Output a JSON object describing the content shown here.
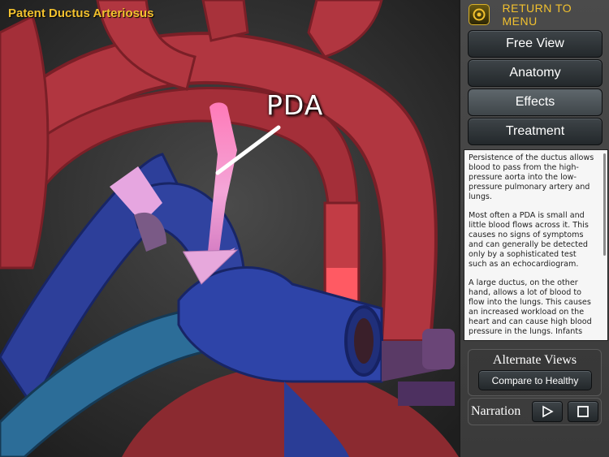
{
  "app": {
    "title": "Patent Ductus Arteriosus"
  },
  "viewport": {
    "annotation_label": "PDA"
  },
  "panel": {
    "return_label": "RETURN TO MENU",
    "nav": [
      {
        "label": "Free View",
        "active": false
      },
      {
        "label": "Anatomy",
        "active": false
      },
      {
        "label": "Effects",
        "active": true
      },
      {
        "label": "Treatment",
        "active": false
      }
    ],
    "description": [
      "Persistence of the ductus allows blood to pass from the high-pressure aorta into the low-pressure pulmonary artery and lungs.",
      "Most often a PDA is small and little blood flows across it. This causes no signs of symptoms and can generally be detected only by a sophisticated test such as an echocardiogram.",
      "A large ductus, on the other hand, allows a lot of blood to flow into the lungs. This causes an increased workload on the heart and can cause high blood pressure in the lungs. Infants"
    ],
    "alternate_views": {
      "title": "Alternate Views",
      "compare_label": "Compare to Healthy"
    },
    "narration": {
      "label": "Narration",
      "play_icon": "play-icon",
      "stop_icon": "stop-icon"
    }
  },
  "colors": {
    "accent_gold": "#f2c12e",
    "artery_red": "#b8303a",
    "vein_blue": "#2d3f9a",
    "flow_pink": "#f08cc8"
  }
}
